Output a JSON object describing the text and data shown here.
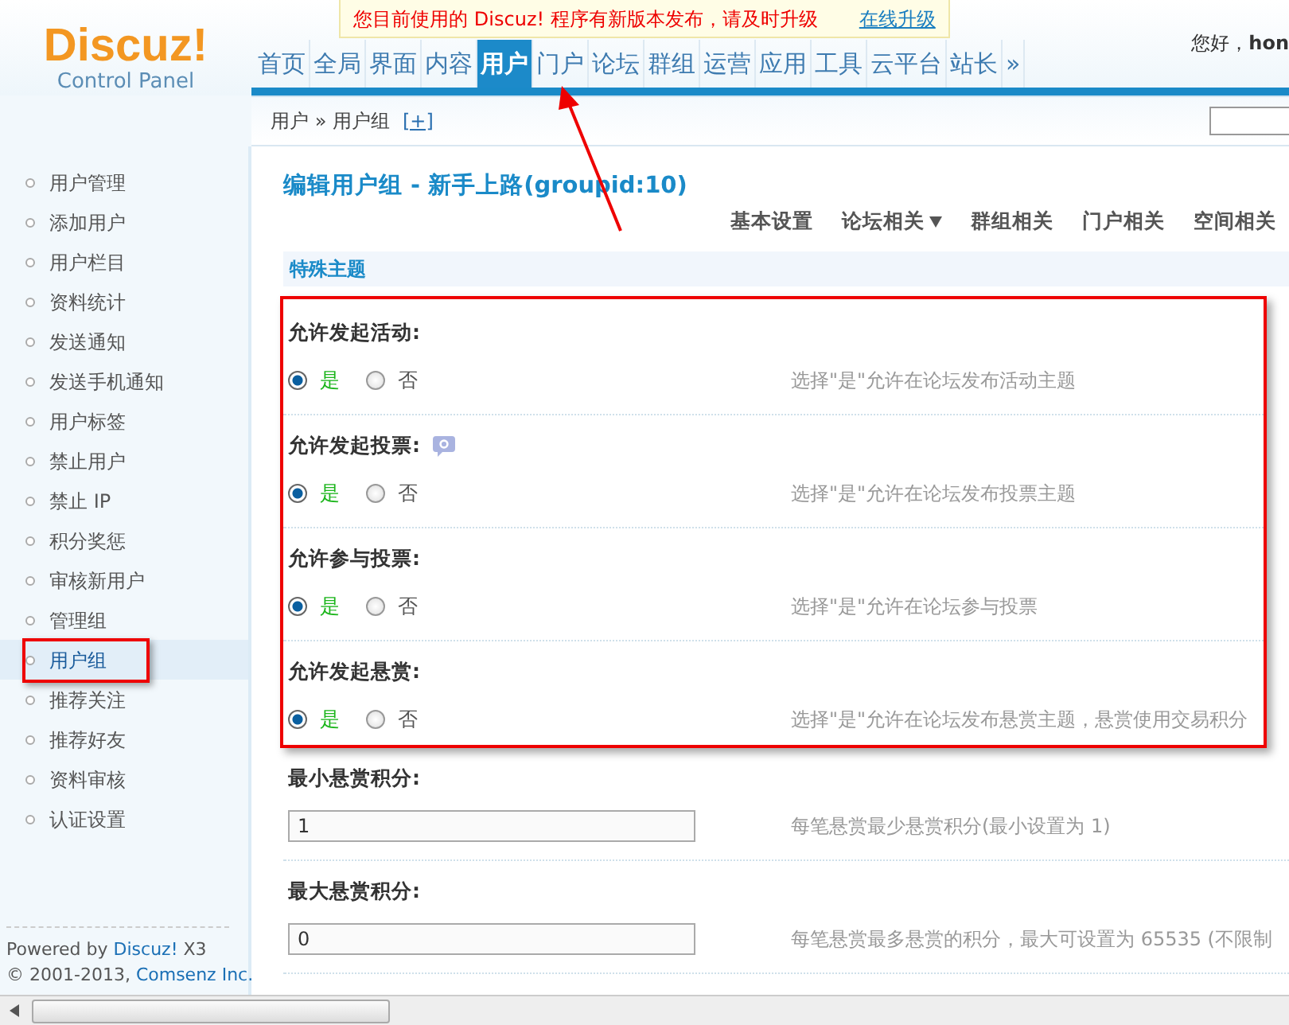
{
  "logo": {
    "name": "Discuz!",
    "subtitle": "Control Panel"
  },
  "notice": {
    "text": "您目前使用的 Discuz! 程序有新版本发布，请及时升级",
    "link": "在线升级"
  },
  "greeting": "您好，**hon**",
  "nav": [
    {
      "label": "首页",
      "selected": false
    },
    {
      "label": "全局",
      "selected": false
    },
    {
      "label": "界面",
      "selected": false
    },
    {
      "label": "内容",
      "selected": false
    },
    {
      "label": "用户",
      "selected": true
    },
    {
      "label": "门户",
      "selected": false
    },
    {
      "label": "论坛",
      "selected": false
    },
    {
      "label": "群组",
      "selected": false
    },
    {
      "label": "运营",
      "selected": false
    },
    {
      "label": "应用",
      "selected": false
    },
    {
      "label": "工具",
      "selected": false
    },
    {
      "label": "云平台",
      "selected": false
    },
    {
      "label": "站长",
      "selected": false
    },
    {
      "label": "»",
      "selected": false
    }
  ],
  "breadcrumb": {
    "items": [
      "用户",
      "用户组"
    ],
    "separator": "»",
    "add": "[+]"
  },
  "sidebar": {
    "items": [
      {
        "label": "用户管理",
        "selected": false,
        "circled": false
      },
      {
        "label": "添加用户",
        "selected": false,
        "circled": false
      },
      {
        "label": "用户栏目",
        "selected": false,
        "circled": false
      },
      {
        "label": "资料统计",
        "selected": false,
        "circled": false
      },
      {
        "label": "发送通知",
        "selected": false,
        "circled": false
      },
      {
        "label": "发送手机通知",
        "selected": false,
        "circled": false
      },
      {
        "label": "用户标签",
        "selected": false,
        "circled": false
      },
      {
        "label": "禁止用户",
        "selected": false,
        "circled": false
      },
      {
        "label": "禁止 IP",
        "selected": false,
        "circled": false
      },
      {
        "label": "积分奖惩",
        "selected": false,
        "circled": false
      },
      {
        "label": "审核新用户",
        "selected": false,
        "circled": false
      },
      {
        "label": "管理组",
        "selected": false,
        "circled": false
      },
      {
        "label": "用户组",
        "selected": true,
        "circled": true
      },
      {
        "label": "推荐关注",
        "selected": false,
        "circled": false
      },
      {
        "label": "推荐好友",
        "selected": false,
        "circled": false
      },
      {
        "label": "资料审核",
        "selected": false,
        "circled": false
      },
      {
        "label": "认证设置",
        "selected": false,
        "circled": false
      }
    ],
    "footer": [
      {
        "text": "Powered by ",
        "link": "Discuz!",
        "rest": " X3"
      },
      {
        "text": "© 2001-2013, ",
        "link": "Comsenz Inc."
      }
    ]
  },
  "page_title": "编辑用户组 - 新手上路(groupid:10)",
  "tabs": [
    {
      "label": "基本设置",
      "dropdown": false
    },
    {
      "label": "论坛相关",
      "dropdown": true
    },
    {
      "label": "群组相关",
      "dropdown": false
    },
    {
      "label": "门户相关",
      "dropdown": false
    },
    {
      "label": "空间相关",
      "dropdown": false
    }
  ],
  "section_title": "特殊主题",
  "fields": [
    {
      "kind": "radio",
      "label": "允许发起活动:",
      "help_icon": false,
      "circled": true,
      "options": [
        {
          "label": "是",
          "selected": true
        },
        {
          "label": "否",
          "selected": false
        }
      ],
      "hint": "选择\"是\"允许在论坛发布活动主题"
    },
    {
      "kind": "radio",
      "label": "允许发起投票:",
      "help_icon": true,
      "circled": true,
      "options": [
        {
          "label": "是",
          "selected": true
        },
        {
          "label": "否",
          "selected": false
        }
      ],
      "hint": "选择\"是\"允许在论坛发布投票主题"
    },
    {
      "kind": "radio",
      "label": "允许参与投票:",
      "help_icon": false,
      "circled": true,
      "options": [
        {
          "label": "是",
          "selected": true
        },
        {
          "label": "否",
          "selected": false
        }
      ],
      "hint": "选择\"是\"允许在论坛参与投票"
    },
    {
      "kind": "radio",
      "label": "允许发起悬赏:",
      "help_icon": false,
      "circled": true,
      "options": [
        {
          "label": "是",
          "selected": true
        },
        {
          "label": "否",
          "selected": false
        }
      ],
      "hint": "选择\"是\"允许在论坛发布悬赏主题，悬赏使用交易积分"
    },
    {
      "kind": "text",
      "label": "最小悬赏积分:",
      "help_icon": false,
      "circled": false,
      "value": "1",
      "hint": "每笔悬赏最少悬赏积分(最小设置为 1)"
    },
    {
      "kind": "text",
      "label": "最大悬赏积分:",
      "help_icon": false,
      "circled": false,
      "value": "0",
      "hint": "每笔悬赏最多悬赏的积分，最大可设置为 65535 (不限制"
    }
  ]
}
